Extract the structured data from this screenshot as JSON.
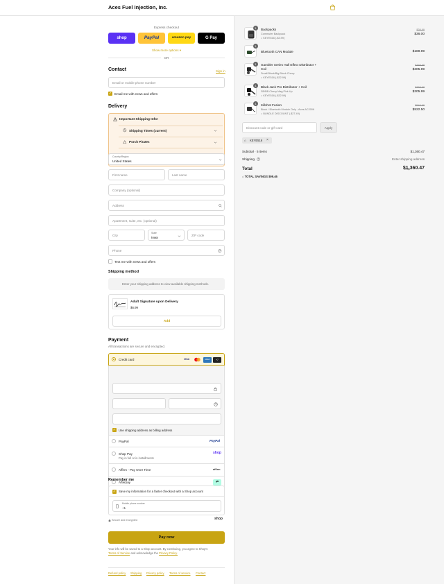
{
  "header": {
    "store_name": "Aces Fuel Injection, Inc."
  },
  "express": {
    "label": "Express checkout",
    "buttons": [
      "shop",
      "PayPal",
      "amazon pay",
      "G Pay"
    ],
    "show_more": "Show more options ▾",
    "or": "OR"
  },
  "contact": {
    "title": "Contact",
    "sign_in": "Sign in",
    "email_placeholder": "Email or mobile phone number",
    "news_label": "Email me with news and offers"
  },
  "delivery": {
    "title": "Delivery",
    "notice_title": "Important Shipping Info!",
    "notice_items": [
      "Shipping Times (current)",
      "Porch Pirates"
    ],
    "country_label": "Country/Region",
    "country_value": "United States",
    "first_name": "First name",
    "last_name": "Last name",
    "company": "Company (optional)",
    "address": "Address",
    "apartment": "Apartment, suite, etc. (optional)",
    "city": "City",
    "state_label": "State",
    "state_value": "Iowa",
    "zip": "ZIP code",
    "phone": "Phone",
    "text_offers": "Text me with news and offers"
  },
  "shipping_method": {
    "title": "Shipping method",
    "message": "Enter your shipping address to view available shipping methods."
  },
  "addon": {
    "name": "Adult Signature upon Delivery",
    "price": "$6.99",
    "add_label": "Add"
  },
  "payment": {
    "title": "Payment",
    "subtitle": "All transactions are secure and encrypted.",
    "credit_card": "Credit card",
    "card_brands": [
      "VISA",
      "MC",
      "AMEX",
      "+7"
    ],
    "billing_label": "Use shipping address as billing address",
    "methods": [
      {
        "name": "PayPal",
        "sub": "",
        "logo": "PayPal"
      },
      {
        "name": "Shop Pay",
        "sub": "Pay in full or in installments",
        "logo": "shop"
      },
      {
        "name": "Affirm - Pay Over Time",
        "sub": "",
        "logo": "affirm"
      },
      {
        "name": "Afterpay",
        "sub": "",
        "logo": "⇄"
      }
    ]
  },
  "remember": {
    "title": "Remember me",
    "save_label": "Save my information for a faster checkout with a Shop account",
    "mobile_label": "Mobile phone number",
    "mobile_value": "+1",
    "secure": "Secure and encrypted",
    "shop_logo": "shop"
  },
  "pay_now": "Pay now",
  "legal": {
    "text1": "Your info will be saved to a Shop account. By continuing, you agree to Shop's",
    "tos": "Terms of Service",
    "text2": "and acknowledge the",
    "privacy": "Privacy Policy."
  },
  "footer_links": [
    "Refund policy",
    "Shipping",
    "Privacy policy",
    "Terms of service",
    "Contact"
  ],
  "cart": {
    "items": [
      {
        "qty": "1",
        "name": "Backpacks",
        "sub": "Commuter Backpack",
        "discount": "KEYE516 (-$3.99)",
        "strike": "$39.99",
        "price": "$36.00"
      },
      {
        "qty": "1",
        "name": "Bluetooth CAN Module",
        "sub": "",
        "discount": "",
        "strike": "",
        "price": "$189.99"
      },
      {
        "qty": "1",
        "name": "Gambler Series Hall Effect Distributor + Coil",
        "sub": "Small Block/Big Block Chevy",
        "discount": "KEYE516 (-$32.99)",
        "strike": "$338.98",
        "price": "$305.99"
      },
      {
        "qty": "1",
        "name": "Black Jack Pro Distributor + Coil",
        "sub": "SB/BB Chevy Mag Pick Up",
        "discount": "KEYE516 (-$32.99)",
        "strike": "$338.98",
        "price": "$305.99"
      },
      {
        "qty": "1",
        "name": "Killshot Fusion",
        "sub": "Black / Bluetooth Module Only - Aces AC2006",
        "discount": "BUNDLE DISCOUNT (-$27.49)",
        "strike": "$549.99",
        "price": "$522.50"
      }
    ],
    "discount_placeholder": "Discount code or gift card",
    "apply": "Apply",
    "code_tag": "KEYE516",
    "subtotal_label": "Subtotal · 5 items",
    "subtotal_value": "$1,360.47",
    "shipping_label": "Shipping",
    "shipping_value": "Enter shipping address",
    "total_label": "Total",
    "currency": "USD",
    "total_value": "$1,360.47",
    "savings_label": "TOTAL SAVINGS",
    "savings_value": "$99.46"
  },
  "colors": {
    "accent": "#c8a413",
    "shop": "#5a31f4",
    "paypal": "#ffc439",
    "amazon": "#ffd814",
    "notice_bg": "#fdf3e7"
  }
}
